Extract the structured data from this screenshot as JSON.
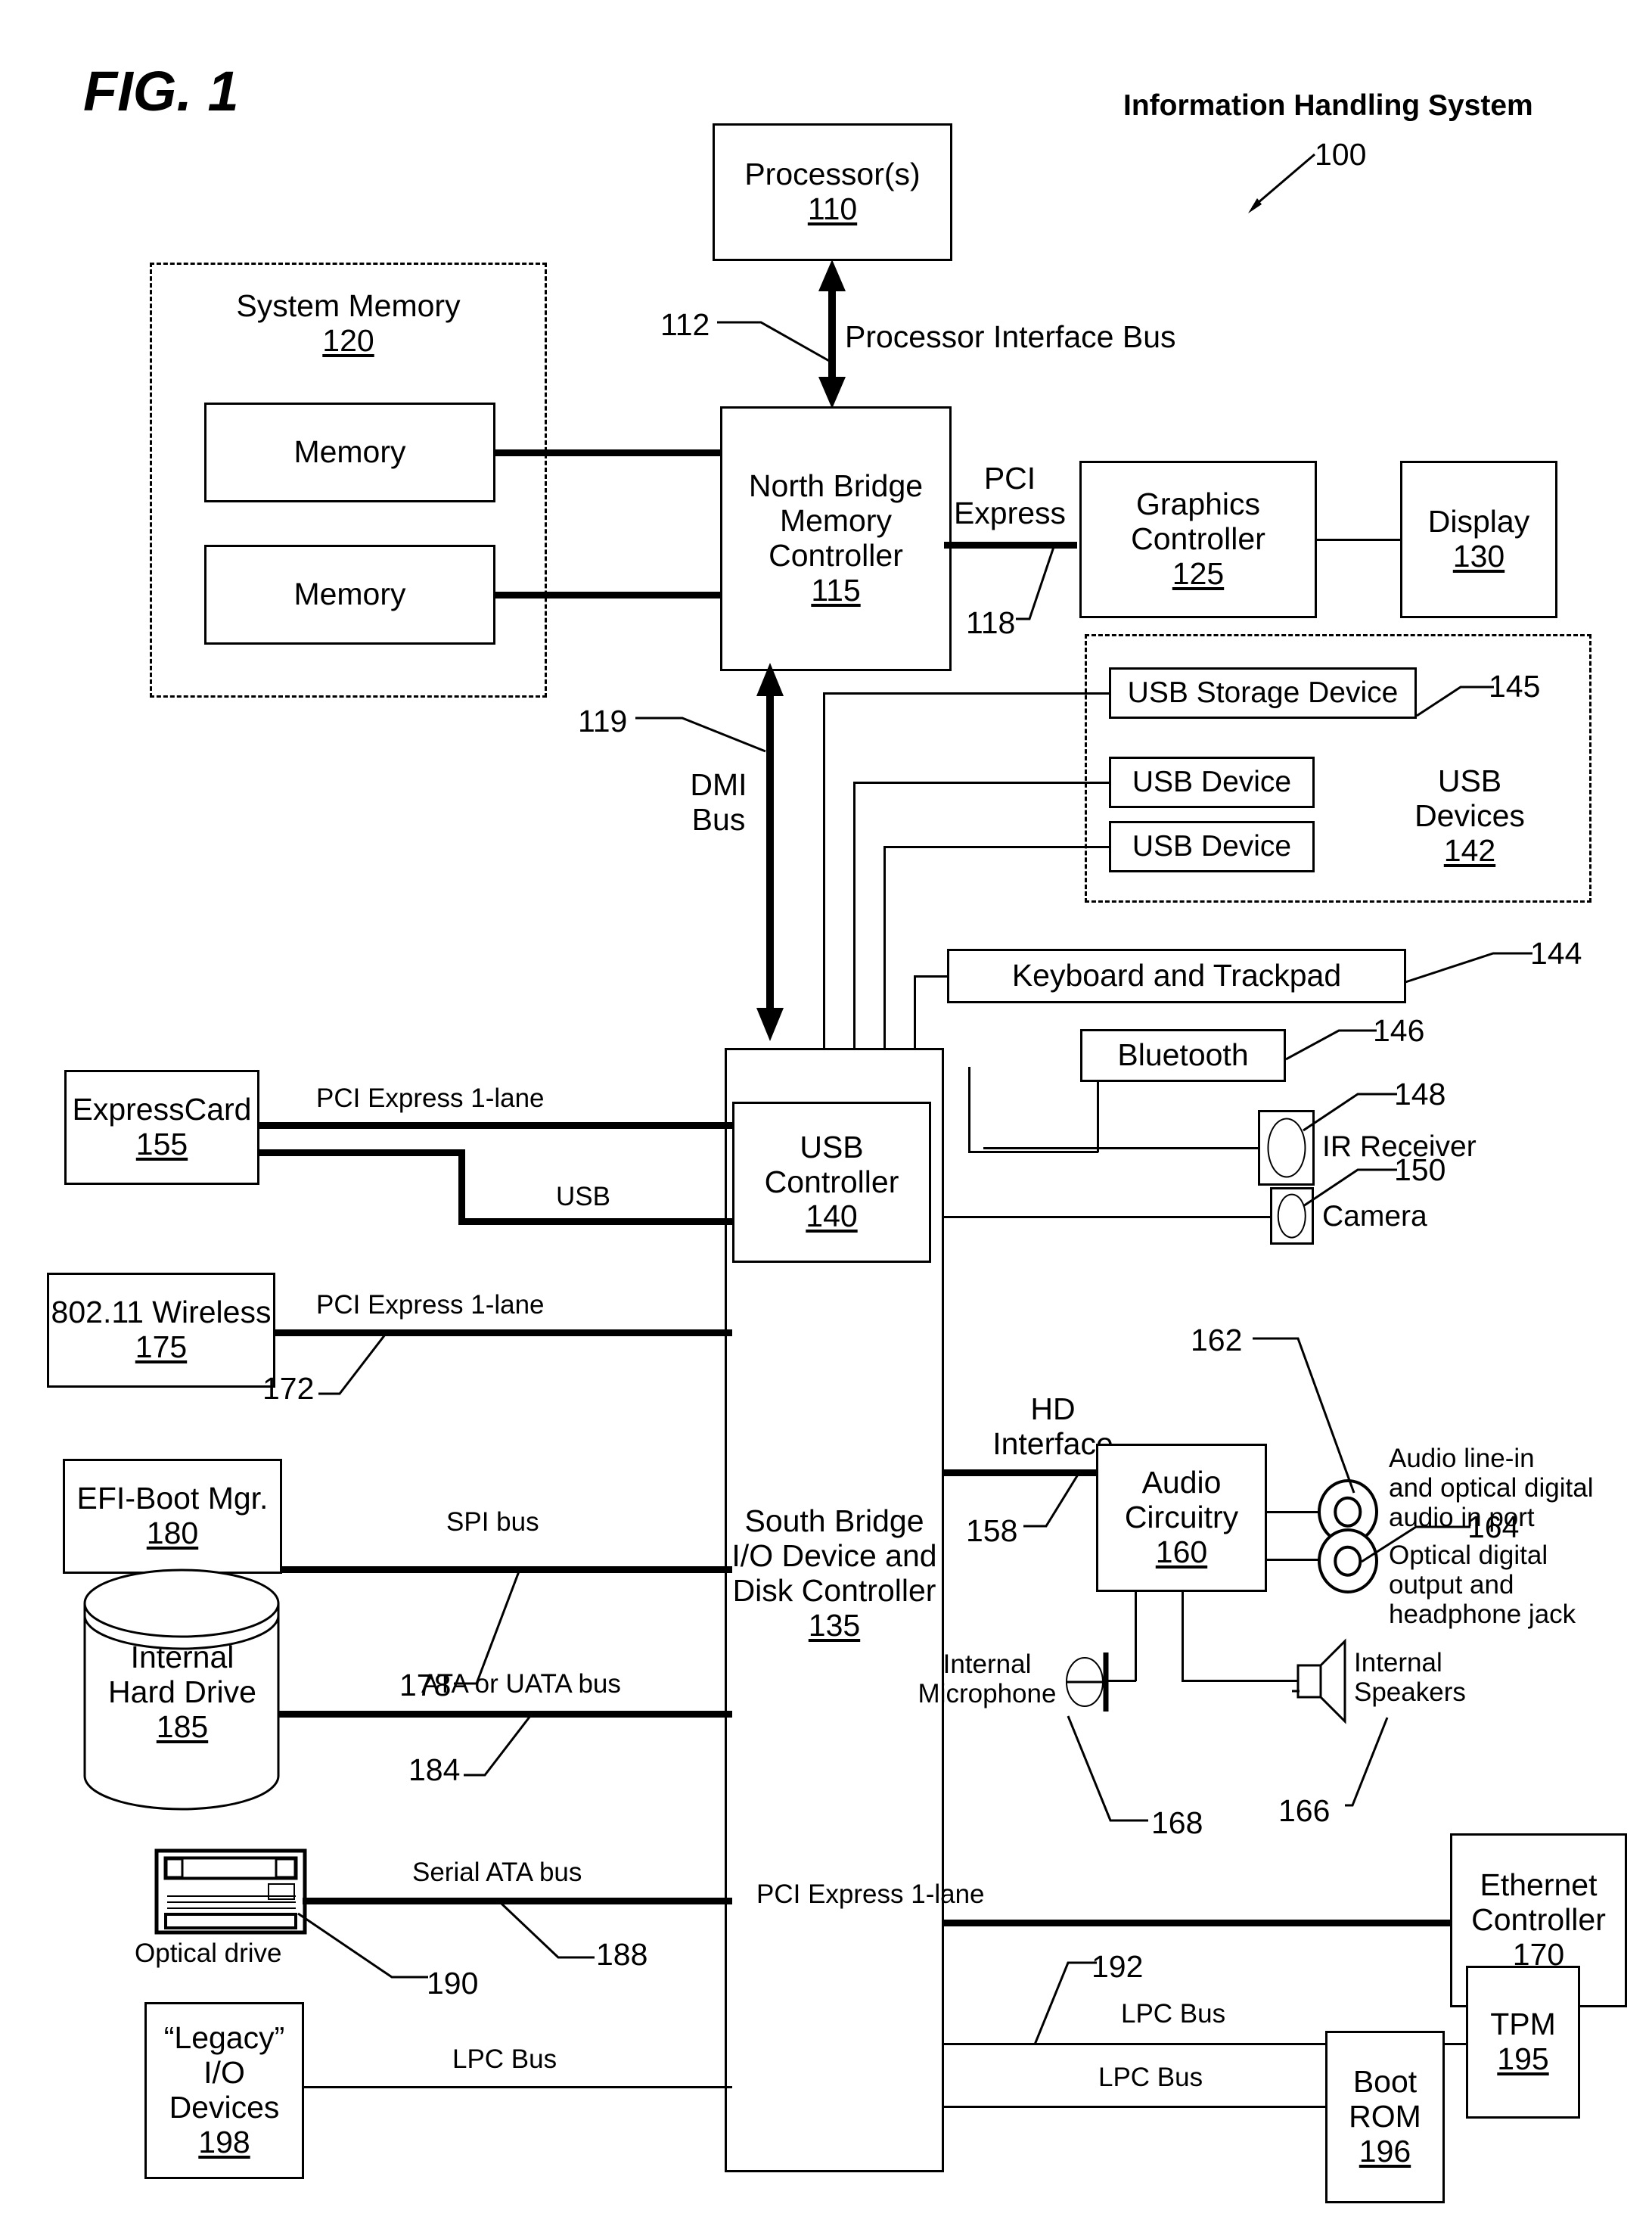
{
  "figure": {
    "label": "FIG. 1",
    "system_title": "Information Handling System",
    "system_ref": "100"
  },
  "blocks": {
    "processor": {
      "title": "Processor(s)",
      "ref": "110"
    },
    "system_memory": {
      "title": "System Memory",
      "ref": "120"
    },
    "memory_1": {
      "title": "Memory"
    },
    "memory_2": {
      "title": "Memory"
    },
    "north_bridge": {
      "line1": "North Bridge",
      "line2": "Memory",
      "line3": "Controller",
      "ref": "115"
    },
    "graphics": {
      "line1": "Graphics",
      "line2": "Controller",
      "ref": "125"
    },
    "display": {
      "title": "Display",
      "ref": "130"
    },
    "usb_devices_group": {
      "line1": "USB",
      "line2": "Devices",
      "ref": "142"
    },
    "usb_storage": {
      "title": "USB Storage Device",
      "ref": "145"
    },
    "usb_device_1": {
      "title": "USB Device"
    },
    "usb_device_2": {
      "title": "USB Device"
    },
    "keyboard": {
      "title": "Keyboard and Trackpad",
      "ref": "144"
    },
    "bluetooth": {
      "title": "Bluetooth",
      "ref": "146"
    },
    "ir_receiver": {
      "title": "IR Receiver",
      "ref": "148"
    },
    "camera": {
      "title": "Camera",
      "ref": "150"
    },
    "usb_controller": {
      "line1": "USB",
      "line2": "Controller",
      "ref": "140"
    },
    "south_bridge": {
      "line1": "South Bridge",
      "line2": "I/O Device and",
      "line3": "Disk Controller",
      "ref": "135"
    },
    "expresscard": {
      "title": "ExpressCard",
      "ref": "155"
    },
    "wireless": {
      "title": "802.11 Wireless",
      "ref": "175"
    },
    "efi_boot_mgr": {
      "title": "EFI-Boot Mgr.",
      "ref": "180"
    },
    "hard_drive": {
      "line1": "Internal",
      "line2": "Hard Drive",
      "ref": "185"
    },
    "optical_drive": {
      "title": "Optical drive",
      "ref": "190"
    },
    "legacy_io": {
      "line1": "“Legacy”",
      "line2": "I/O",
      "line3": "Devices",
      "ref": "198"
    },
    "audio_circuitry": {
      "line1": "Audio",
      "line2": "Circuitry",
      "ref": "160"
    },
    "audio_line_in": {
      "line1": "Audio line-in",
      "line2": "and optical digital",
      "line3": "audio in port",
      "ref": "162"
    },
    "optical_out": {
      "line1": "Optical digital",
      "line2": "output and",
      "line3": "headphone jack",
      "ref": "164"
    },
    "internal_mic": {
      "line1": "Internal",
      "line2": "Microphone",
      "ref": "168"
    },
    "internal_speakers": {
      "line1": "Internal",
      "line2": "Speakers",
      "ref": "166"
    },
    "ethernet": {
      "line1": "Ethernet",
      "line2": "Controller",
      "ref": "170"
    },
    "tpm": {
      "title": "TPM",
      "ref": "195"
    },
    "boot_rom": {
      "line1": "Boot",
      "line2": "ROM",
      "ref": "196"
    }
  },
  "buses": {
    "processor_interface": {
      "label": "Processor Interface Bus",
      "ref": "112"
    },
    "pci_express_gfx": {
      "line1": "PCI",
      "line2": "Express",
      "ref": "118"
    },
    "dmi": {
      "line1": "DMI",
      "line2": "Bus",
      "ref": "119"
    },
    "expresscard_pcie": {
      "label": "PCI Express 1-lane"
    },
    "expresscard_usb": {
      "label": "USB"
    },
    "wireless_pcie": {
      "label": "PCI Express 1-lane",
      "ref": "172"
    },
    "spi": {
      "label": "SPI bus",
      "ref": "178"
    },
    "ata": {
      "label": "ATA or UATA bus",
      "ref": "184"
    },
    "sata": {
      "label": "Serial ATA bus",
      "ref": "188"
    },
    "legacy_lpc": {
      "label": "LPC Bus"
    },
    "hd_interface": {
      "line1": "HD",
      "line2": "Interface",
      "ref": "158"
    },
    "ethernet_pcie": {
      "label": "PCI Express 1-lane"
    },
    "tpm_lpc": {
      "label": "LPC Bus",
      "ref": "192"
    },
    "bootrom_lpc": {
      "label": "LPC Bus"
    }
  },
  "colors": {
    "stroke": "#000000",
    "background": "#ffffff"
  }
}
